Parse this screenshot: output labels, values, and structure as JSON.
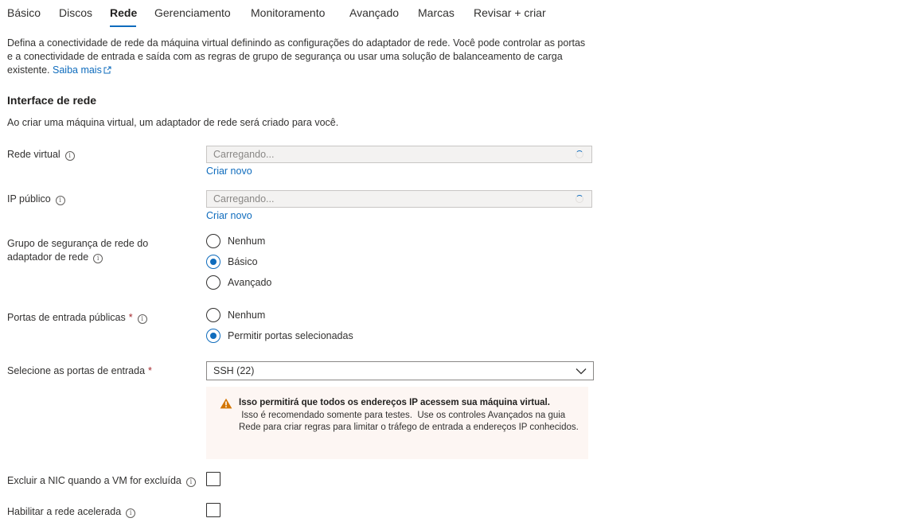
{
  "tabs": [
    {
      "label": "Básico",
      "active": false
    },
    {
      "label": "Discos",
      "active": false
    },
    {
      "label": "Rede",
      "active": true
    },
    {
      "label": "Gerenciamento",
      "active": false
    },
    {
      "label": "Monitoramento",
      "active": false
    },
    {
      "label": "Avançado",
      "active": false
    },
    {
      "label": "Marcas",
      "active": false
    },
    {
      "label": "Revisar + criar",
      "active": false
    }
  ],
  "description": {
    "text": "Defina a conectividade de rede da máquina virtual definindo as configurações do adaptador de rede. Você pode controlar as portas e a conectividade de entrada e saída com as regras de grupo de segurança ou usar uma solução de balanceamento de carga existente.",
    "learn_more": "Saiba mais"
  },
  "section": {
    "title": "Interface de rede",
    "subtitle": "Ao criar uma máquina virtual, um adaptador de rede será criado para você."
  },
  "virtual_network": {
    "label": "Rede virtual",
    "placeholder": "Carregando...",
    "create_new": "Criar novo"
  },
  "public_ip": {
    "label": "IP público",
    "placeholder": "Carregando...",
    "create_new": "Criar novo"
  },
  "nsg": {
    "label_line1": "Grupo de segurança de rede do",
    "label_line2": "adaptador de rede",
    "options": [
      "Nenhum",
      "Básico",
      "Avançado"
    ],
    "selected": "Básico"
  },
  "public_ports": {
    "label": "Portas de entrada públicas",
    "required_mark": "*",
    "options": [
      "Nenhum",
      "Permitir portas selecionadas"
    ],
    "selected": "Permitir portas selecionadas"
  },
  "inbound_ports": {
    "label": "Selecione as portas de entrada",
    "required_mark": "*",
    "value": "SSH (22)"
  },
  "warning": {
    "icon": "warning-triangle-icon",
    "color": "#d47500",
    "title": "Isso permitirá que todos os endereços IP acessem sua máquina virtual.",
    "body": " Isso é recomendado somente para testes.  Use os controles Avançados na guia Rede para criar regras para limitar o tráfego de entrada a endereços IP conhecidos."
  },
  "delete_nic": {
    "label": "Excluir a NIC quando a VM for excluída",
    "checked": false
  },
  "accelerated": {
    "label": "Habilitar a rede acelerada",
    "checked": false
  },
  "colors": {
    "accent": "#0f6cbd",
    "warning_bg": "#fdf6f3"
  }
}
